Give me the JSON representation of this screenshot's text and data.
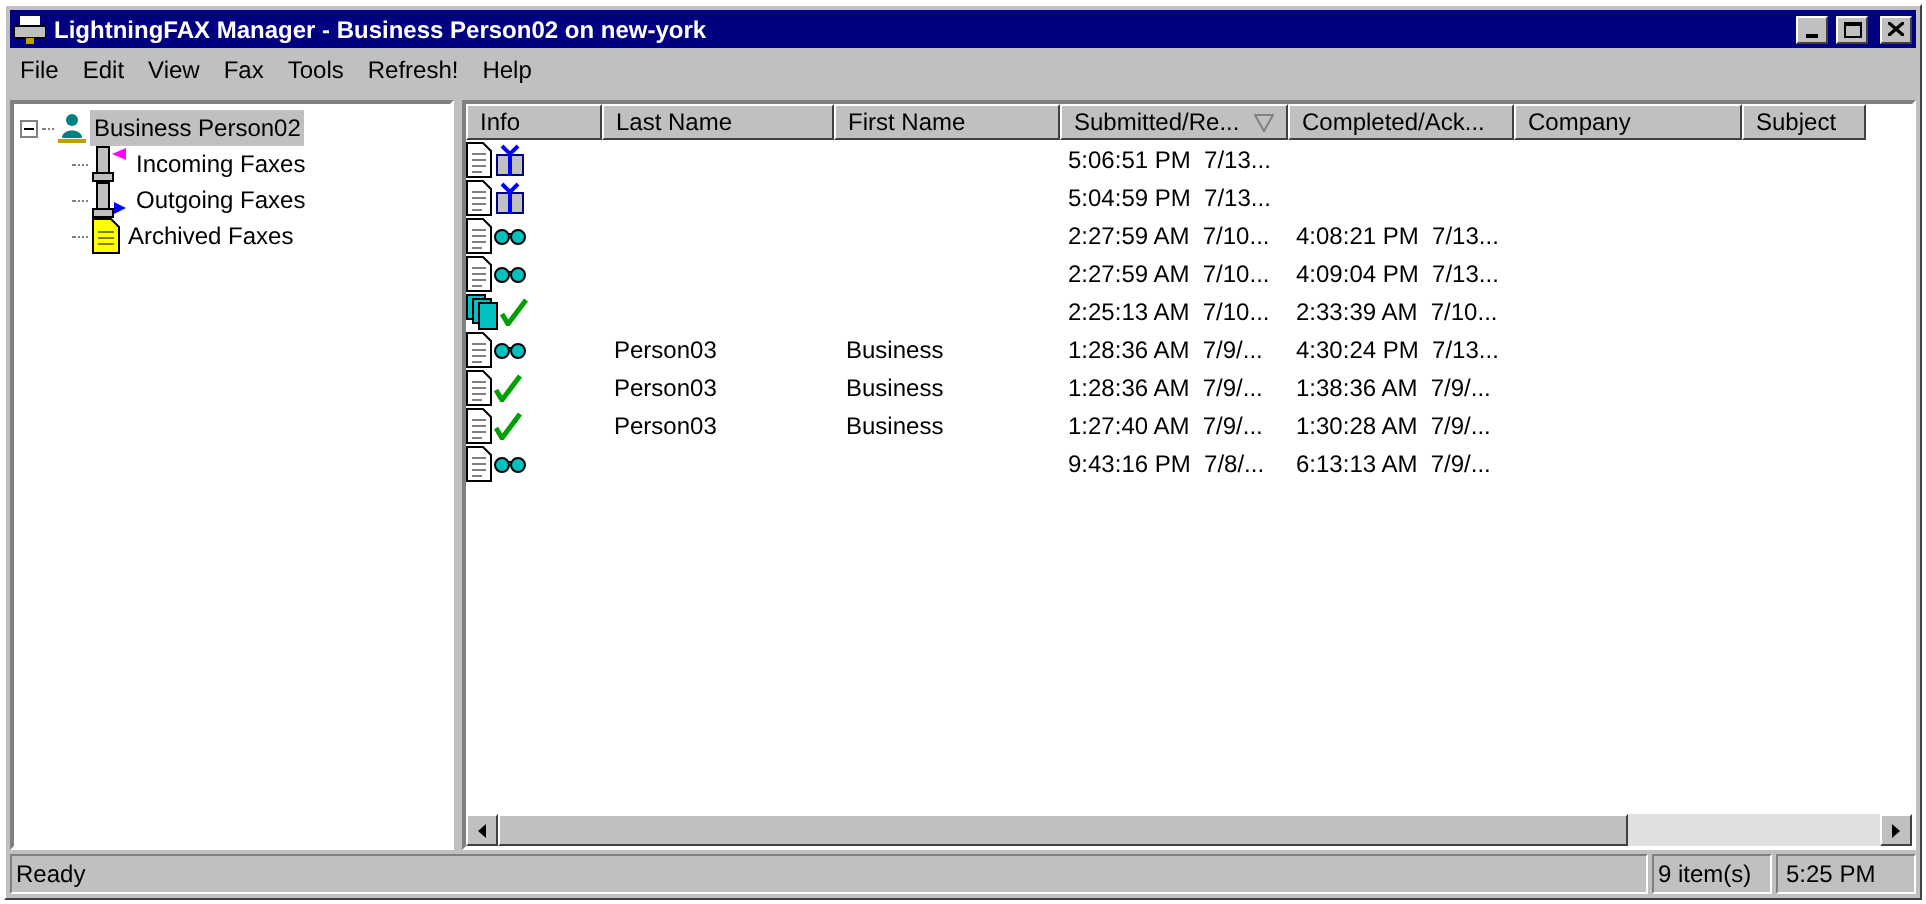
{
  "window": {
    "title": "LightningFAX Manager - Business Person02 on new-york"
  },
  "menu": [
    "File",
    "Edit",
    "View",
    "Fax",
    "Tools",
    "Refresh!",
    "Help"
  ],
  "tree": [
    {
      "label": "Business Person02",
      "kind": "user",
      "selected": true,
      "expanded": true,
      "children": [
        {
          "label": "Incoming Faxes",
          "kind": "incoming",
          "selected": false
        },
        {
          "label": "Outgoing Faxes",
          "kind": "outgoing",
          "selected": false
        },
        {
          "label": "Archived Faxes",
          "kind": "archive",
          "selected": false
        }
      ]
    }
  ],
  "table": {
    "columns": [
      {
        "label": "Info",
        "sorted": false
      },
      {
        "label": "Last Name",
        "sorted": false
      },
      {
        "label": "First Name",
        "sorted": false
      },
      {
        "label": "Submitted/Re...",
        "sorted": true
      },
      {
        "label": "Completed/Ack...",
        "sorted": false
      },
      {
        "label": "Company",
        "sorted": false
      },
      {
        "label": "Subject",
        "sorted": false
      }
    ],
    "rows": [
      {
        "info": [
          {
            "kind": "document"
          },
          {
            "kind": "gift"
          }
        ],
        "last_name": "",
        "first_name": "",
        "submitted": "5:06:51 PM  7/13...",
        "completed": ""
      },
      {
        "info": [
          {
            "kind": "document"
          },
          {
            "kind": "gift"
          }
        ],
        "last_name": "",
        "first_name": "",
        "submitted": "5:04:59 PM  7/13...",
        "completed": ""
      },
      {
        "info": [
          {
            "kind": "document"
          },
          {
            "kind": "glasses"
          }
        ],
        "last_name": "",
        "first_name": "",
        "submitted": "2:27:59 AM  7/10...",
        "completed": "4:08:21 PM  7/13..."
      },
      {
        "info": [
          {
            "kind": "document"
          },
          {
            "kind": "glasses"
          }
        ],
        "last_name": "",
        "first_name": "",
        "submitted": "2:27:59 AM  7/10...",
        "completed": "4:09:04 PM  7/13..."
      },
      {
        "info": [
          {
            "kind": "pages"
          },
          {
            "kind": "check"
          }
        ],
        "last_name": "",
        "first_name": "",
        "submitted": "2:25:13 AM  7/10...",
        "completed": "2:33:39 AM  7/10..."
      },
      {
        "info": [
          {
            "kind": "document"
          },
          {
            "kind": "glasses"
          }
        ],
        "last_name": "Person03",
        "first_name": "Business",
        "submitted": "1:28:36 AM  7/9/...",
        "completed": "4:30:24 PM  7/13..."
      },
      {
        "info": [
          {
            "kind": "document"
          },
          {
            "kind": "check"
          }
        ],
        "last_name": "Person03",
        "first_name": "Business",
        "submitted": "1:28:36 AM  7/9/...",
        "completed": "1:38:36 AM  7/9/..."
      },
      {
        "info": [
          {
            "kind": "document"
          },
          {
            "kind": "check"
          }
        ],
        "last_name": "Person03",
        "first_name": "Business",
        "submitted": "1:27:40 AM  7/9/...",
        "completed": "1:30:28 AM  7/9/..."
      },
      {
        "info": [
          {
            "kind": "document"
          },
          {
            "kind": "glasses"
          }
        ],
        "last_name": "",
        "first_name": "",
        "submitted": "9:43:16 PM  7/8/...",
        "completed": "6:13:13 AM  7/9/..."
      }
    ]
  },
  "status_bar": {
    "message": "Ready",
    "count": "9 item(s)",
    "time": "5:25 PM"
  }
}
